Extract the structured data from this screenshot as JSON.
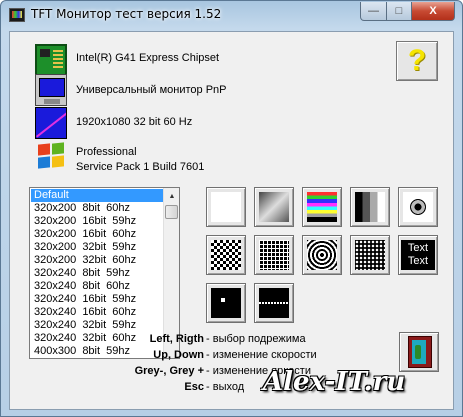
{
  "window": {
    "title": "TFT Монитор тест версия 1.52",
    "min_glyph": "—",
    "max_glyph": "□",
    "close_glyph": "X"
  },
  "info": {
    "chipset": "Intel(R) G41 Express Chipset",
    "monitor": "Универсальный монитор PnP",
    "resolution": "1920x1080 32 bit 60 Hz",
    "os_line1": "Professional",
    "os_line2": "Service Pack 1 Build 7601"
  },
  "help_button": {
    "label": "?"
  },
  "modes": {
    "items": [
      "Default",
      "320x200  8bit  60hz",
      "320x200  16bit  59hz",
      "320x200  16bit  60hz",
      "320x200  32bit  59hz",
      "320x200  32bit  60hz",
      "320x240  8bit  59hz",
      "320x240  8bit  60hz",
      "320x240  16bit  59hz",
      "320x240  16bit  60hz",
      "320x240  32bit  59hz",
      "320x240  32bit  60hz",
      "400x300  8bit  59hz"
    ],
    "selected_index": 0
  },
  "tests": {
    "row1": [
      "white-screen",
      "gradient",
      "color-bars",
      "gray-bars",
      "circle"
    ],
    "row2": [
      "checkerboard",
      "grid",
      "rings",
      "dot-matrix",
      "text"
    ],
    "row3": [
      "single-dot",
      "dashed-line"
    ],
    "text_line1": "Text",
    "text_line2": "Text"
  },
  "legend": [
    {
      "key": "Left, Rigth",
      "desc": " - выбор подрежима"
    },
    {
      "key": "Up, Down",
      "desc": " - изменение скорости"
    },
    {
      "key": "Grey-, Grey +",
      "desc": " - изменение яркости"
    },
    {
      "key": "Esc",
      "desc": " - выход"
    }
  ],
  "watermark": "Alex-IT.ru"
}
